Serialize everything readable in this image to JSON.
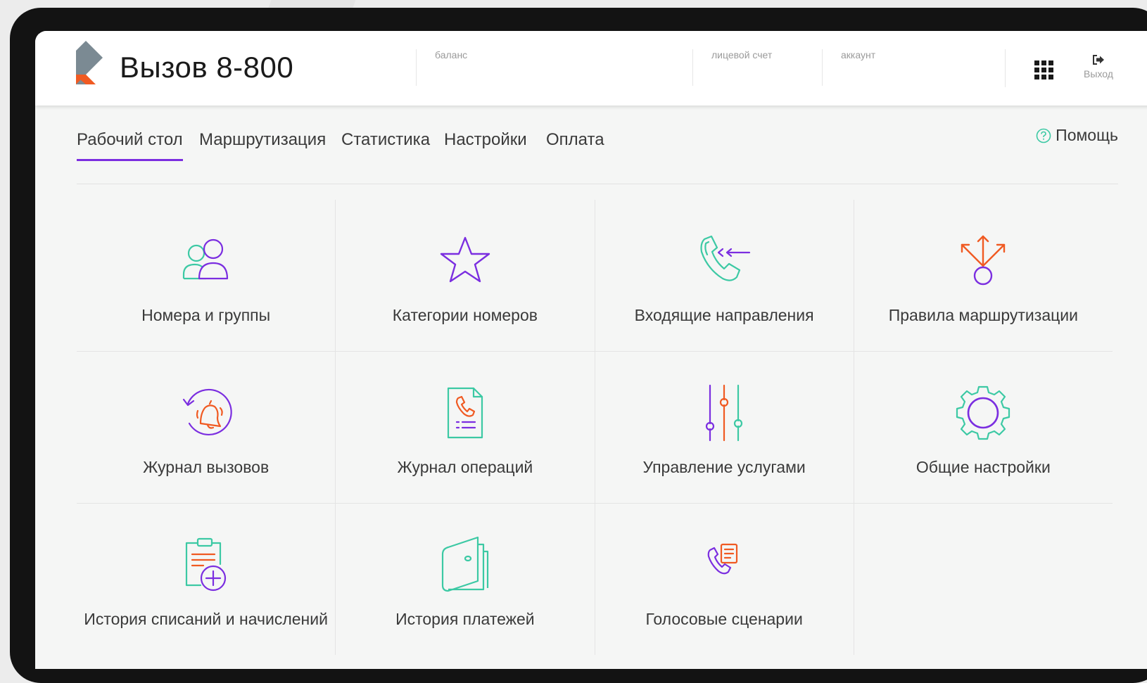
{
  "app": {
    "title": "Вызов 8-800"
  },
  "header": {
    "balance_label": "баланс",
    "balance_value": "",
    "account_label": "лицевой счет",
    "account_value": "",
    "user_label": "аккаунт",
    "user_value": "",
    "apps_icon": "grid-icon",
    "logout_label": "Выход",
    "logout_icon": "sign-out-icon"
  },
  "nav": {
    "tabs": [
      {
        "label": "Рабочий стол",
        "active": true
      },
      {
        "label": "Маршрутизация",
        "active": false
      },
      {
        "label": "Статистика",
        "active": false
      },
      {
        "label": "Настройки",
        "active": false
      },
      {
        "label": "Оплата",
        "active": false
      }
    ],
    "help_label": "Помощь",
    "help_icon": "question-circle-icon"
  },
  "tiles": [
    {
      "label": "Номера и группы",
      "icon": "users-icon"
    },
    {
      "label": "Категории номеров",
      "icon": "star-icon"
    },
    {
      "label": "Входящие направления",
      "icon": "incoming-call-icon"
    },
    {
      "label": "Правила маршрутизации",
      "icon": "routing-arrows-icon"
    },
    {
      "label": "Журнал вызовов",
      "icon": "call-history-bell-icon"
    },
    {
      "label": "Журнал операций",
      "icon": "phone-document-icon"
    },
    {
      "label": "Управление услугами",
      "icon": "sliders-icon"
    },
    {
      "label": "Общие настройки",
      "icon": "gear-icon"
    },
    {
      "label": "История списаний и начислений",
      "icon": "clipboard-plus-icon"
    },
    {
      "label": "История платежей",
      "icon": "wallet-icon"
    },
    {
      "label": "Голосовые сценарии",
      "icon": "phone-script-icon"
    }
  ],
  "colors": {
    "accent_purple": "#7b2ee0",
    "accent_teal": "#3cc9a4",
    "accent_orange": "#f05a22",
    "logo_gray": "#7b8a93"
  }
}
